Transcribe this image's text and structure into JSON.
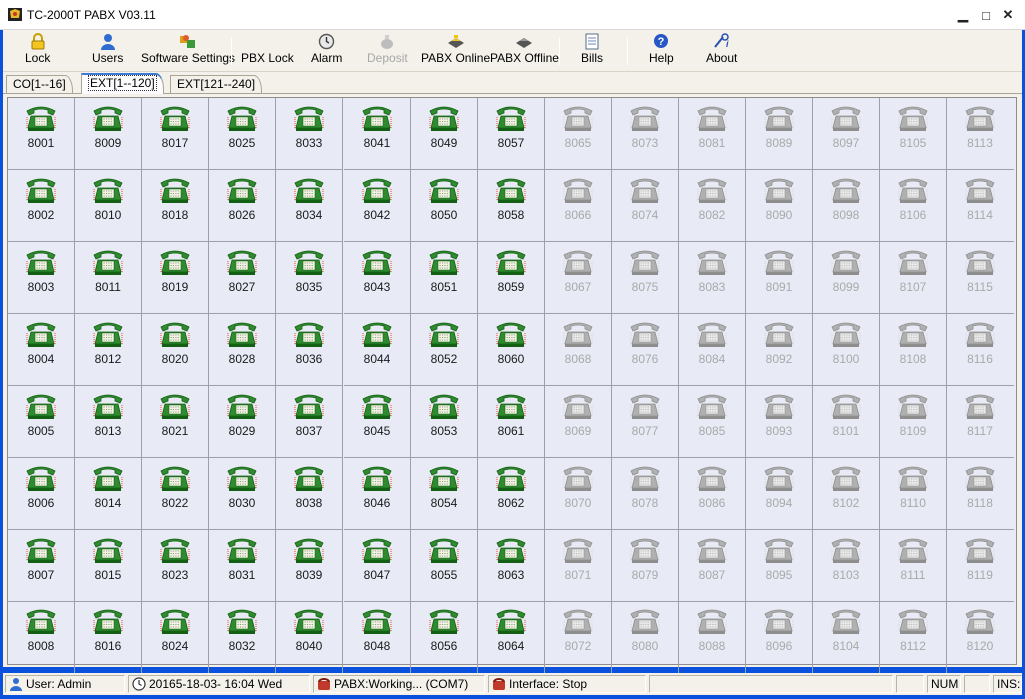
{
  "window": {
    "title": "TC-2000T PABX V03.11",
    "minimize": "▁",
    "maximize": "□",
    "close": "✕"
  },
  "toolbar": {
    "items": [
      {
        "label": "Lock",
        "icon": "lock-icon",
        "enabled": true
      },
      {
        "label": "Users",
        "icon": "users-icon",
        "enabled": true
      },
      {
        "label": "Software Settings",
        "icon": "settings-icon",
        "enabled": true
      },
      {
        "label": "PBX Lock",
        "icon": "none",
        "enabled": true
      },
      {
        "label": "Alarm",
        "icon": "alarm-icon",
        "enabled": true
      },
      {
        "label": "Deposit",
        "icon": "deposit-icon",
        "enabled": false
      },
      {
        "label": "PABX Online",
        "icon": "online-icon",
        "enabled": true
      },
      {
        "label": "PABX Offline",
        "icon": "offline-icon",
        "enabled": true
      },
      {
        "label": "Bills",
        "icon": "bills-icon",
        "enabled": true
      },
      {
        "label": "Help",
        "icon": "help-icon",
        "enabled": true
      },
      {
        "label": "About",
        "icon": "about-icon",
        "enabled": true
      }
    ]
  },
  "tabs": [
    {
      "label": "CO[1--16]",
      "active": false
    },
    {
      "label": "EXT[1--120]",
      "active": true
    },
    {
      "label": "EXT[121--240]",
      "active": false
    }
  ],
  "extensions": {
    "online_color": "#2e8b2e",
    "offline_color": "#b0b0b0",
    "rows": [
      [
        {
          "n": "8001",
          "on": true
        },
        {
          "n": "8009",
          "on": true
        },
        {
          "n": "8017",
          "on": true
        },
        {
          "n": "8025",
          "on": true
        },
        {
          "n": "8033",
          "on": true
        },
        {
          "n": "8041",
          "on": true
        },
        {
          "n": "8049",
          "on": true
        },
        {
          "n": "8057",
          "on": true
        },
        {
          "n": "8065",
          "on": false
        },
        {
          "n": "8073",
          "on": false
        },
        {
          "n": "8081",
          "on": false
        },
        {
          "n": "8089",
          "on": false
        },
        {
          "n": "8097",
          "on": false
        },
        {
          "n": "8105",
          "on": false
        },
        {
          "n": "8113",
          "on": false
        }
      ],
      [
        {
          "n": "8002",
          "on": true
        },
        {
          "n": "8010",
          "on": true
        },
        {
          "n": "8018",
          "on": true
        },
        {
          "n": "8026",
          "on": true
        },
        {
          "n": "8034",
          "on": true
        },
        {
          "n": "8042",
          "on": true
        },
        {
          "n": "8050",
          "on": true
        },
        {
          "n": "8058",
          "on": true
        },
        {
          "n": "8066",
          "on": false
        },
        {
          "n": "8074",
          "on": false
        },
        {
          "n": "8082",
          "on": false
        },
        {
          "n": "8090",
          "on": false
        },
        {
          "n": "8098",
          "on": false
        },
        {
          "n": "8106",
          "on": false
        },
        {
          "n": "8114",
          "on": false
        }
      ],
      [
        {
          "n": "8003",
          "on": true
        },
        {
          "n": "8011",
          "on": true
        },
        {
          "n": "8019",
          "on": true
        },
        {
          "n": "8027",
          "on": true
        },
        {
          "n": "8035",
          "on": true
        },
        {
          "n": "8043",
          "on": true
        },
        {
          "n": "8051",
          "on": true
        },
        {
          "n": "8059",
          "on": true
        },
        {
          "n": "8067",
          "on": false
        },
        {
          "n": "8075",
          "on": false
        },
        {
          "n": "8083",
          "on": false
        },
        {
          "n": "8091",
          "on": false
        },
        {
          "n": "8099",
          "on": false
        },
        {
          "n": "8107",
          "on": false
        },
        {
          "n": "8115",
          "on": false
        }
      ],
      [
        {
          "n": "8004",
          "on": true
        },
        {
          "n": "8012",
          "on": true
        },
        {
          "n": "8020",
          "on": true
        },
        {
          "n": "8028",
          "on": true
        },
        {
          "n": "8036",
          "on": true
        },
        {
          "n": "8044",
          "on": true
        },
        {
          "n": "8052",
          "on": true
        },
        {
          "n": "8060",
          "on": true
        },
        {
          "n": "8068",
          "on": false
        },
        {
          "n": "8076",
          "on": false
        },
        {
          "n": "8084",
          "on": false
        },
        {
          "n": "8092",
          "on": false
        },
        {
          "n": "8100",
          "on": false
        },
        {
          "n": "8108",
          "on": false
        },
        {
          "n": "8116",
          "on": false
        }
      ],
      [
        {
          "n": "8005",
          "on": true
        },
        {
          "n": "8013",
          "on": true
        },
        {
          "n": "8021",
          "on": true
        },
        {
          "n": "8029",
          "on": true
        },
        {
          "n": "8037",
          "on": true
        },
        {
          "n": "8045",
          "on": true
        },
        {
          "n": "8053",
          "on": true
        },
        {
          "n": "8061",
          "on": true
        },
        {
          "n": "8069",
          "on": false
        },
        {
          "n": "8077",
          "on": false
        },
        {
          "n": "8085",
          "on": false
        },
        {
          "n": "8093",
          "on": false
        },
        {
          "n": "8101",
          "on": false
        },
        {
          "n": "8109",
          "on": false
        },
        {
          "n": "8117",
          "on": false
        }
      ],
      [
        {
          "n": "8006",
          "on": true
        },
        {
          "n": "8014",
          "on": true
        },
        {
          "n": "8022",
          "on": true
        },
        {
          "n": "8030",
          "on": true
        },
        {
          "n": "8038",
          "on": true
        },
        {
          "n": "8046",
          "on": true
        },
        {
          "n": "8054",
          "on": true
        },
        {
          "n": "8062",
          "on": true
        },
        {
          "n": "8070",
          "on": false
        },
        {
          "n": "8078",
          "on": false
        },
        {
          "n": "8086",
          "on": false
        },
        {
          "n": "8094",
          "on": false
        },
        {
          "n": "8102",
          "on": false
        },
        {
          "n": "8110",
          "on": false
        },
        {
          "n": "8118",
          "on": false
        }
      ],
      [
        {
          "n": "8007",
          "on": true
        },
        {
          "n": "8015",
          "on": true
        },
        {
          "n": "8023",
          "on": true
        },
        {
          "n": "8031",
          "on": true
        },
        {
          "n": "8039",
          "on": true
        },
        {
          "n": "8047",
          "on": true
        },
        {
          "n": "8055",
          "on": true
        },
        {
          "n": "8063",
          "on": true
        },
        {
          "n": "8071",
          "on": false
        },
        {
          "n": "8079",
          "on": false
        },
        {
          "n": "8087",
          "on": false
        },
        {
          "n": "8095",
          "on": false
        },
        {
          "n": "8103",
          "on": false
        },
        {
          "n": "8111",
          "on": false
        },
        {
          "n": "8119",
          "on": false
        }
      ],
      [
        {
          "n": "8008",
          "on": true
        },
        {
          "n": "8016",
          "on": true
        },
        {
          "n": "8024",
          "on": true
        },
        {
          "n": "8032",
          "on": true
        },
        {
          "n": "8040",
          "on": true
        },
        {
          "n": "8048",
          "on": true
        },
        {
          "n": "8056",
          "on": true
        },
        {
          "n": "8064",
          "on": true
        },
        {
          "n": "8072",
          "on": false
        },
        {
          "n": "8080",
          "on": false
        },
        {
          "n": "8088",
          "on": false
        },
        {
          "n": "8096",
          "on": false
        },
        {
          "n": "8104",
          "on": false
        },
        {
          "n": "8112",
          "on": false
        },
        {
          "n": "8120",
          "on": false
        }
      ]
    ]
  },
  "statusbar": {
    "user": "User: Admin",
    "datetime": "20165-18-03- 16:04  Wed",
    "pabx": "PABX:Working... (COM7)",
    "interface": "Interface: Stop",
    "num": "NUM",
    "ins": "INS:"
  }
}
